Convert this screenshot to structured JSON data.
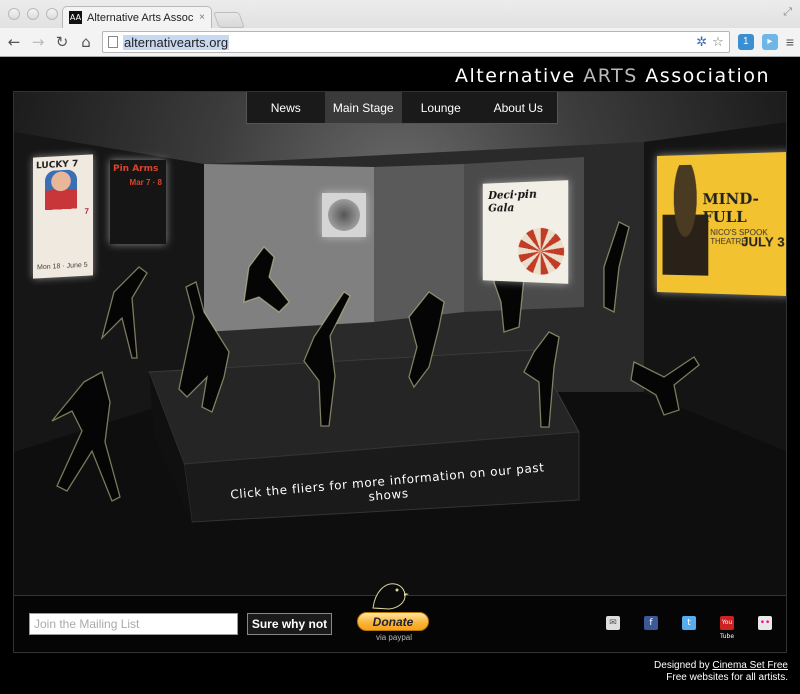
{
  "browser": {
    "tab_title": "Alternative Arts Association",
    "tab_close": "×",
    "url": "alternativearts.org",
    "ext_badge": "1"
  },
  "site": {
    "title_prefix": "Alternative ",
    "title_arts": "ARTS",
    "title_suffix": " Association"
  },
  "nav": {
    "items": [
      {
        "label": "News"
      },
      {
        "label": "Main Stage"
      },
      {
        "label": "Lounge"
      },
      {
        "label": "About Us"
      }
    ],
    "active": "Main Stage"
  },
  "fliers": {
    "f1": {
      "title": "LUCKY 7",
      "date": "7",
      "sub": "Mon 18 · June 5"
    },
    "f2": {
      "title": "Pin Arms",
      "date": "Mar 7 · 8"
    },
    "f4": {
      "title": "Deci·pin Gala"
    },
    "f5": {
      "title": "MIND-FULL",
      "date": "JULY 3",
      "sub": "NICO'S SPOOK THEATRE"
    }
  },
  "stage_text": "Click the fliers for more information on our past shows",
  "footer": {
    "mail_placeholder": "Join the Mailing List",
    "submit_label": "Sure why not",
    "donate_label": "Donate",
    "donate_sub": "via paypal"
  },
  "social": {
    "mail": "✉",
    "facebook": "f",
    "twitter": "t",
    "youtube": "You Tube",
    "flickr": "••"
  },
  "credits": {
    "line1_prefix": "Designed by ",
    "line1_link": "Cinema Set Free",
    "line2": "Free websites for all artists."
  }
}
